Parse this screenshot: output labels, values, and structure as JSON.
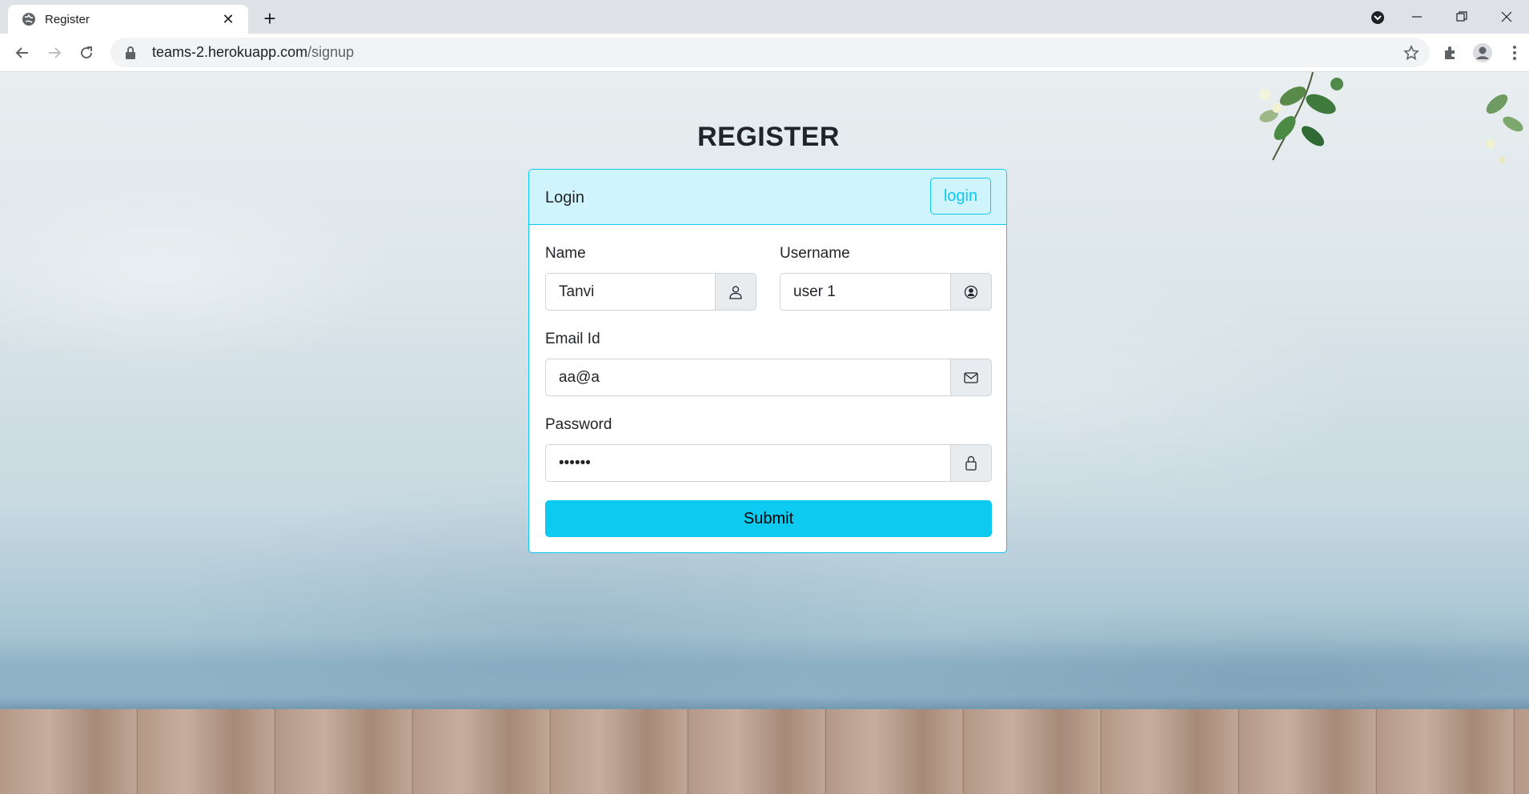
{
  "browser": {
    "tab_title": "Register",
    "url_host": "teams-2.herokuapp.com",
    "url_path": "/signup"
  },
  "page": {
    "title": "REGISTER",
    "card_header": "Login",
    "login_button": "login",
    "name_label": "Name",
    "name_value": "Tanvi",
    "username_label": "Username",
    "username_value": "user 1",
    "email_label": "Email Id",
    "email_value": "aa@a",
    "password_label": "Password",
    "password_value": "••••••",
    "submit_button": "Submit"
  },
  "colors": {
    "accent": "#0dcaf0",
    "header_bg": "#cff4fc"
  }
}
